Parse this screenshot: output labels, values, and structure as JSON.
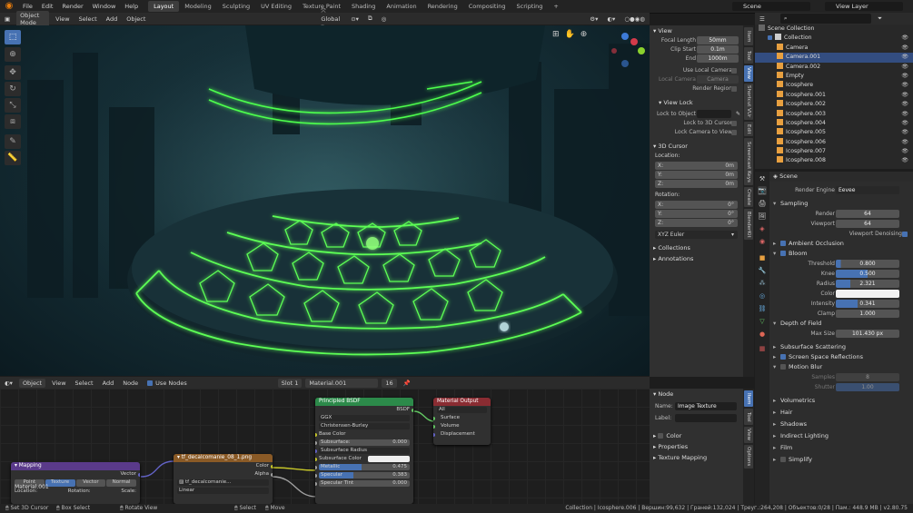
{
  "topbar": {
    "menus": [
      "File",
      "Edit",
      "Render",
      "Window",
      "Help"
    ],
    "workspaces": [
      "Layout",
      "Modeling",
      "Sculpting",
      "UV Editing",
      "Texture Paint",
      "Shading",
      "Animation",
      "Rendering",
      "Compositing",
      "Scripting"
    ],
    "active_workspace": "Layout",
    "scene": "Scene",
    "view_layer": "View Layer"
  },
  "viewport_header": {
    "mode": "Object Mode",
    "menus": [
      "View",
      "Select",
      "Add",
      "Object"
    ],
    "transform": "Global"
  },
  "npanel": {
    "view_title": "View",
    "focal_length_label": "Focal Length",
    "focal_length": "50mm",
    "clip_start_label": "Clip Start",
    "clip_start": "0.1m",
    "end_label": "End",
    "end": "1000m",
    "use_local_camera": "Use Local Camera",
    "local_camera_label": "Local Camera",
    "local_camera": "Camera",
    "render_region": "Render Region",
    "view_lock_title": "View Lock",
    "lock_to_object": "Lock to Object",
    "lock_to_3d_cursor": "Lock to 3D Cursor",
    "lock_camera_to_view": "Lock Camera to View",
    "cursor_title": "3D Cursor",
    "location_label": "Location:",
    "loc": [
      {
        "a": "X:",
        "v": "0m"
      },
      {
        "a": "Y:",
        "v": "0m"
      },
      {
        "a": "Z:",
        "v": "0m"
      }
    ],
    "rotation_label": "Rotation:",
    "rot": [
      {
        "a": "X:",
        "v": "0°"
      },
      {
        "a": "Y:",
        "v": "0°"
      },
      {
        "a": "Z:",
        "v": "0°"
      }
    ],
    "rotation_mode": "XYZ Euler",
    "collections": "Collections",
    "annotations": "Annotations",
    "tabs": [
      "Item",
      "Tool",
      "View",
      "Shortcut VUr",
      "Edit",
      "Screencast Keys",
      "Create",
      "BlenderKit",
      "Options"
    ]
  },
  "outliner": {
    "scene_collection": "Scene Collection",
    "collection": "Collection",
    "items": [
      "Camera",
      "Camera.001",
      "Camera.002",
      "Empty",
      "Icosphere",
      "Icosphere.001",
      "Icosphere.002",
      "Icosphere.003",
      "Icosphere.004",
      "Icosphere.005",
      "Icosphere.006",
      "Icosphere.007",
      "Icosphere.008"
    ],
    "selected": "Camera.001"
  },
  "properties": {
    "scene": "Scene",
    "render_engine_label": "Render Engine",
    "render_engine": "Eevee",
    "sampling": "Sampling",
    "render_label": "Render",
    "render": "64",
    "viewport_label": "Viewport",
    "viewport": "64",
    "viewport_denoising": "Viewport Denoising",
    "ambient_occlusion": "Ambient Occlusion",
    "bloom": "Bloom",
    "threshold_label": "Threshold",
    "threshold": "0.800",
    "threshold_fill": 0.08,
    "knee_label": "Knee",
    "knee": "0.500",
    "knee_fill": 0.5,
    "radius_label": "Radius",
    "radius": "2.321",
    "radius_fill": 0.23,
    "color_label": "Color",
    "intensity_label": "Intensity",
    "intensity": "0.341",
    "intensity_fill": 0.34,
    "clamp_label": "Clamp",
    "clamp": "1.000",
    "depth_of_field": "Depth of Field",
    "max_size_label": "Max Size",
    "max_size": "101.430 px",
    "subsurface": "Subsurface Scattering",
    "screen_space_reflections": "Screen Space Reflections",
    "motion_blur": "Motion Blur",
    "samples_label": "Samples",
    "samples": "8",
    "shutter_label": "Shutter",
    "shutter": "1.00",
    "volumetrics": "Volumetrics",
    "hair": "Hair",
    "shadows": "Shadows",
    "indirect_lighting": "Indirect Lighting",
    "film": "Film",
    "simplify": "Simplify"
  },
  "node_header": {
    "type": "Object",
    "menus": [
      "View",
      "Select",
      "Add",
      "Node"
    ],
    "use_nodes": "Use Nodes",
    "slot": "Slot 1",
    "material": "Material.001",
    "users": "16"
  },
  "nodes": {
    "principled": {
      "title": "Principled BSDF",
      "out": "BSDF",
      "dist": "GGX",
      "sss_method": "Christensen-Burley",
      "base_color": "Base Color",
      "subsurface": "Subsurface:",
      "subsurface_val": "0.000",
      "subsurface_radius": "Subsurface Radius",
      "subsurface_color": "Subsurface Color",
      "metallic": "Metallic",
      "metallic_val": "0.475",
      "specular": "Specular",
      "specular_val": "0.383",
      "specular_tint": "Specular Tint",
      "specular_tint_val": "0.000"
    },
    "output": {
      "title": "Material Output",
      "target": "All",
      "surface": "Surface",
      "volume": "Volume",
      "displacement": "Displacement"
    },
    "image": {
      "title": "tf_decalcomanie_08_1.png",
      "color": "Color",
      "alpha": "Alpha",
      "file": "tf_decalcomanie...",
      "interp": "Linear"
    },
    "mapping": {
      "title": "Mapping",
      "out": "Vector",
      "type": "Point",
      "types": [
        "Point",
        "Texture",
        "Vector",
        "Normal"
      ],
      "location": "Location:",
      "rotation": "Rotation:",
      "scale": "Scale:",
      "name": "Material.001"
    }
  },
  "node_side": {
    "node": "Node",
    "name_label": "Name:",
    "name": "Image Texture",
    "label_label": "Label:",
    "color": "Color",
    "properties": "Properties",
    "texture_mapping": "Texture Mapping",
    "tabs": [
      "Item",
      "Tool",
      "View",
      "Options"
    ]
  },
  "statusbar": {
    "left": [
      "Set 3D Cursor",
      "Box Select",
      "Rotate View",
      "Select",
      "Move"
    ],
    "right": "Collection | Icosphere.006 | Вершин:99,632 | Граней:132,024 | Треуг.:264,208 | Объектов:0/28 | Пам.: 448.9 MB | v2.80.75"
  },
  "colors": {
    "accent": "#4772b3",
    "orange": "#e87d0d",
    "glow": "#4dff4d"
  }
}
